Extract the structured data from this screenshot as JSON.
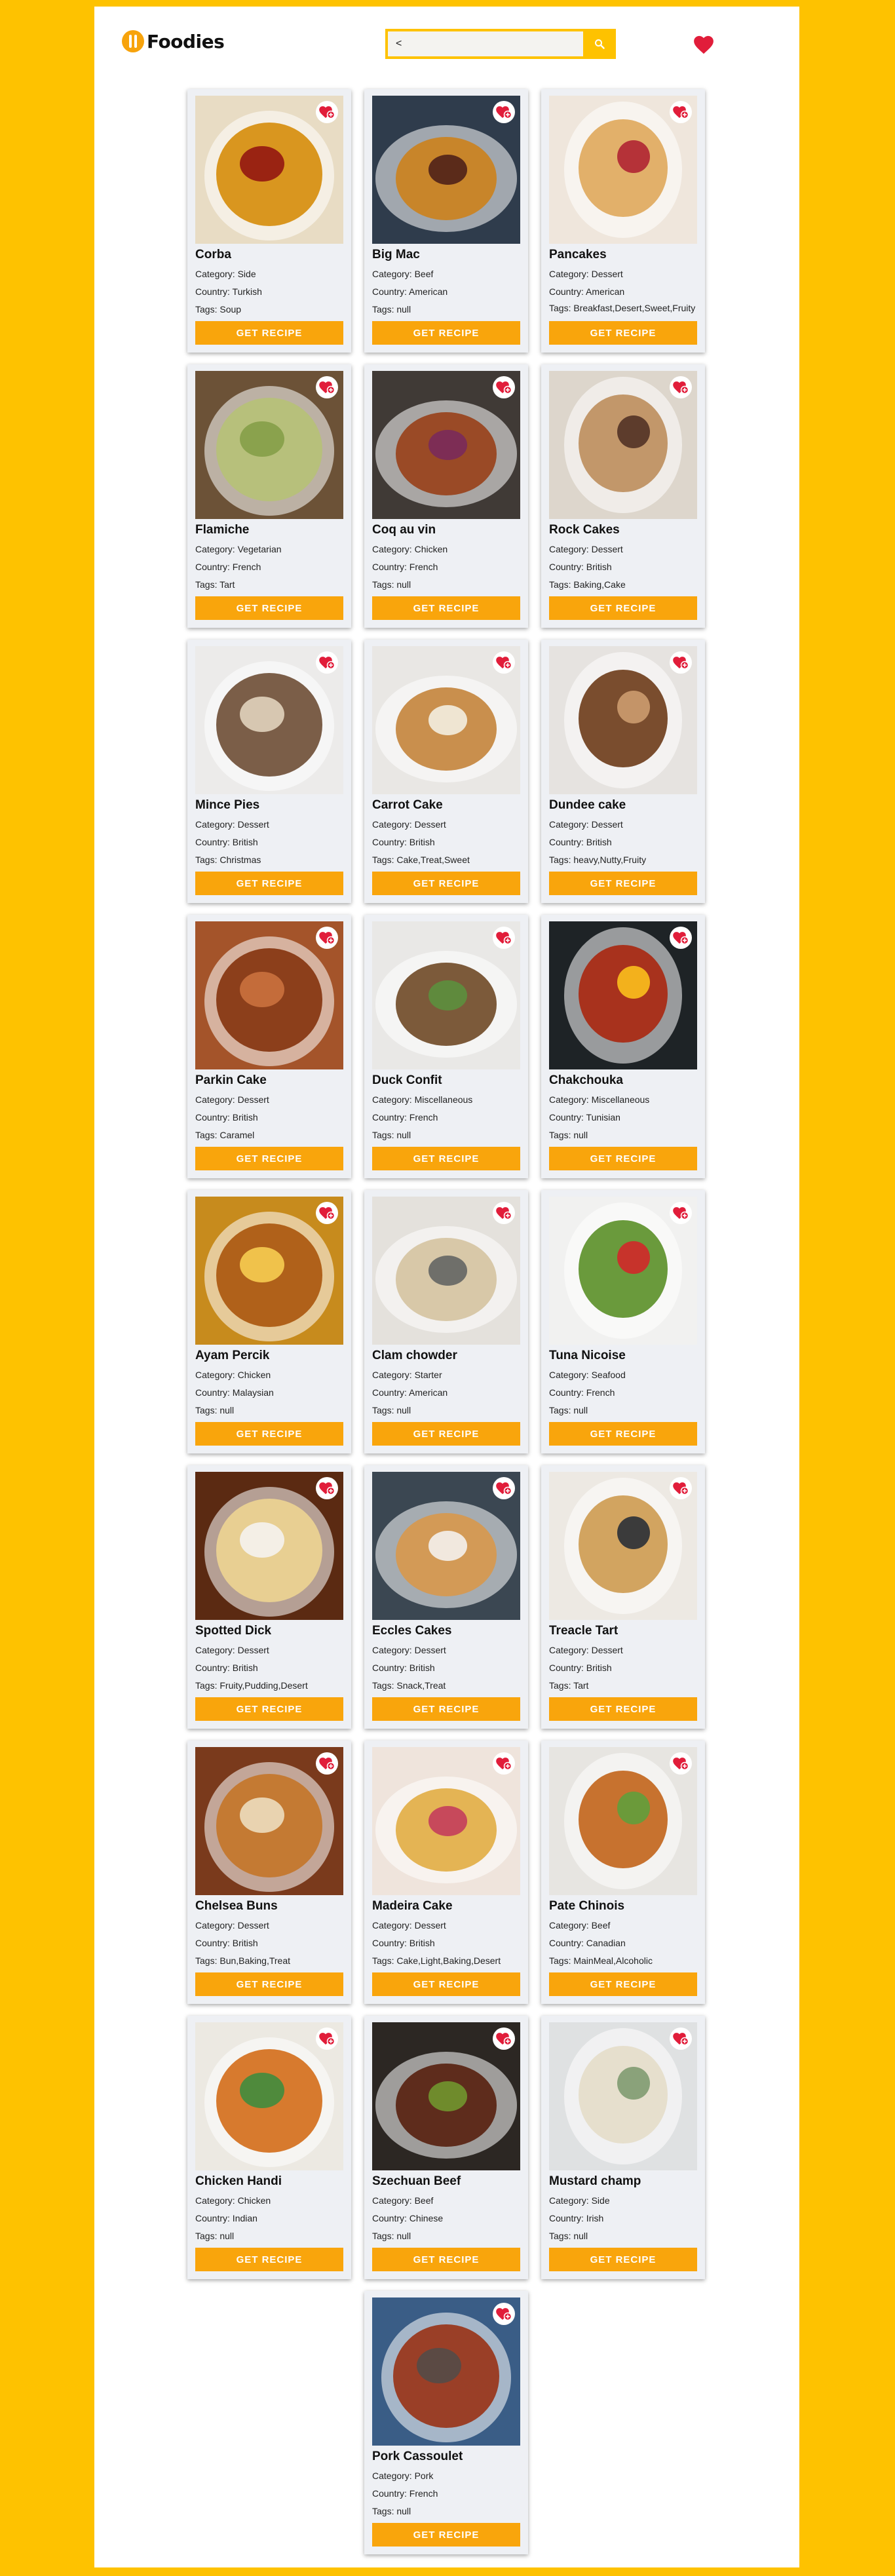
{
  "header": {
    "logo_text": "Foodies",
    "search": {
      "value": "<",
      "placeholder": ""
    }
  },
  "recipes": [
    {
      "name": "Corba",
      "category": "Side",
      "country": "Turkish",
      "tags": "Soup",
      "bg": "#e8dcc4",
      "food": "#d9961f",
      "accent": "#9a2312"
    },
    {
      "name": "Big Mac",
      "category": "Beef",
      "country": "American",
      "tags": "null",
      "bg": "#2f3c4c",
      "food": "#c8852a",
      "accent": "#5b2b1a"
    },
    {
      "name": "Pancakes",
      "category": "Dessert",
      "country": "American",
      "tags": "Breakfast,Desert,Sweet,Fruity",
      "bg": "#efe6dc",
      "food": "#e2b06a",
      "accent": "#b53238"
    },
    {
      "name": "Flamiche",
      "category": "Vegetarian",
      "country": "French",
      "tags": "Tart",
      "bg": "#6c5237",
      "food": "#b7c07b",
      "accent": "#8aa24d"
    },
    {
      "name": "Coq au vin",
      "category": "Chicken",
      "country": "French",
      "tags": "null",
      "bg": "#403a36",
      "food": "#9a4a26",
      "accent": "#7d2d55"
    },
    {
      "name": "Rock Cakes",
      "category": "Dessert",
      "country": "British",
      "tags": "Baking,Cake",
      "bg": "#ddd6cc",
      "food": "#c2976a",
      "accent": "#5d3c2c"
    },
    {
      "name": "Mince Pies",
      "category": "Dessert",
      "country": "British",
      "tags": "Christmas",
      "bg": "#ecebea",
      "food": "#7b5e48",
      "accent": "#d7c7b1"
    },
    {
      "name": "Carrot Cake",
      "category": "Dessert",
      "country": "British",
      "tags": "Cake,Treat,Sweet",
      "bg": "#e9e7e4",
      "food": "#c98f4d",
      "accent": "#efe5d2"
    },
    {
      "name": "Dundee cake",
      "category": "Dessert",
      "country": "British",
      "tags": "heavy,Nutty,Fruity",
      "bg": "#e6e3e0",
      "food": "#7a4d2e",
      "accent": "#c49468"
    },
    {
      "name": "Parkin Cake",
      "category": "Dessert",
      "country": "British",
      "tags": "Caramel",
      "bg": "#a4542a",
      "food": "#8c3f1b",
      "accent": "#c46c3a"
    },
    {
      "name": "Duck Confit",
      "category": "Miscellaneous",
      "country": "French",
      "tags": "null",
      "bg": "#e9e8e6",
      "food": "#7c5a3a",
      "accent": "#5f8a3d"
    },
    {
      "name": "Chakchouka",
      "category": "Miscellaneous",
      "country": "Tunisian",
      "tags": "null",
      "bg": "#1e2326",
      "food": "#a8321d",
      "accent": "#f3b11c"
    },
    {
      "name": "Ayam Percik",
      "category": "Chicken",
      "country": "Malaysian",
      "tags": "null",
      "bg": "#c78b1d",
      "food": "#b0611a",
      "accent": "#f0c24b"
    },
    {
      "name": "Clam chowder",
      "category": "Starter",
      "country": "American",
      "tags": "null",
      "bg": "#e4e1dc",
      "food": "#d8c8a8",
      "accent": "#6f6f6a"
    },
    {
      "name": "Tuna Nicoise",
      "category": "Seafood",
      "country": "French",
      "tags": "null",
      "bg": "#f1f1f0",
      "food": "#6a9a3c",
      "accent": "#c7332b"
    },
    {
      "name": "Spotted Dick",
      "category": "Dessert",
      "country": "British",
      "tags": "Fruity,Pudding,Desert",
      "bg": "#5b2a12",
      "food": "#e8cf92",
      "accent": "#f4efe6"
    },
    {
      "name": "Eccles Cakes",
      "category": "Dessert",
      "country": "British",
      "tags": "Snack,Treat",
      "bg": "#3b4752",
      "food": "#d39a56",
      "accent": "#f1e8de"
    },
    {
      "name": "Treacle Tart",
      "category": "Dessert",
      "country": "British",
      "tags": "Tart",
      "bg": "#ede9e3",
      "food": "#d2a460",
      "accent": "#3b3b3b"
    },
    {
      "name": "Chelsea Buns",
      "category": "Dessert",
      "country": "British",
      "tags": "Bun,Baking,Treat",
      "bg": "#7a3a1c",
      "food": "#c47a33",
      "accent": "#e9d3b0"
    },
    {
      "name": "Madeira Cake",
      "category": "Dessert",
      "country": "British",
      "tags": "Cake,Light,Baking,Desert",
      "bg": "#efe4dc",
      "food": "#e4b454",
      "accent": "#c7495b"
    },
    {
      "name": "Pate Chinois",
      "category": "Beef",
      "country": "Canadian",
      "tags": "MainMeal,Alcoholic",
      "bg": "#e7e5e1",
      "food": "#c7722f",
      "accent": "#6b9a3a"
    },
    {
      "name": "Chicken Handi",
      "category": "Chicken",
      "country": "Indian",
      "tags": "null",
      "bg": "#ece9e2",
      "food": "#d77a2e",
      "accent": "#4f8a3c"
    },
    {
      "name": "Szechuan Beef",
      "category": "Beef",
      "country": "Chinese",
      "tags": "null",
      "bg": "#2c2723",
      "food": "#5e2c1c",
      "accent": "#6f8b2c"
    },
    {
      "name": "Mustard champ",
      "category": "Side",
      "country": "Irish",
      "tags": "null",
      "bg": "#dfe1e2",
      "food": "#e6dfcd",
      "accent": "#8aa27a"
    },
    {
      "name": "Pork Cassoulet",
      "category": "Pork",
      "country": "French",
      "tags": "null",
      "bg": "#3a5d86",
      "food": "#9a3f27",
      "accent": "#5b4a44"
    }
  ],
  "labels": {
    "category_prefix": "Category: ",
    "country_prefix": "Country: ",
    "tags_prefix": "Tags: ",
    "button": "GET RECIPE"
  },
  "colors": {
    "page_bg": "#fec200",
    "button_bg": "#f9a50c",
    "heart": "#e11d3a",
    "card_bg": "#eef0f4"
  },
  "icons": {
    "logo": "fork-spoon-icon",
    "search": "search-icon",
    "favorites": "heart-icon",
    "like": "heart-plus-icon"
  }
}
